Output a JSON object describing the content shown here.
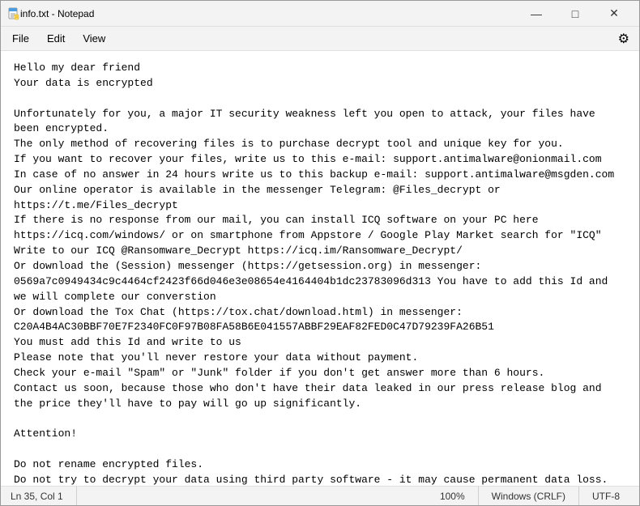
{
  "window": {
    "title": "info.txt - Notepad"
  },
  "menu": {
    "file_label": "File",
    "edit_label": "Edit",
    "view_label": "View"
  },
  "content": {
    "text": "Hello my dear friend\nYour data is encrypted\n\nUnfortunately for you, a major IT security weakness left you open to attack, your files have\nbeen encrypted.\nThe only method of recovering files is to purchase decrypt tool and unique key for you.\nIf you want to recover your files, write us to this e-mail: support.antimalware@onionmail.com\nIn case of no answer in 24 hours write us to this backup e-mail: support.antimalware@msgden.com\nOur online operator is available in the messenger Telegram: @Files_decrypt or\nhttps://t.me/Files_decrypt\nIf there is no response from our mail, you can install ICQ software on your PC here\nhttps://icq.com/windows/ or on smartphone from Appstore / Google Play Market search for \"ICQ\"\nWrite to our ICQ @Ransomware_Decrypt https://icq.im/Ransomware_Decrypt/\nOr download the (Session) messenger (https://getsession.org) in messenger:\n0569a7c0949434c9c4464cf2423f66d046e3e08654e4164404b1dc23783096d313 You have to add this Id and\nwe will complete our converstion\nOr download the Tox Chat (https://tox.chat/download.html) in messenger:\nC20A4B4AC30BBF70E7F2340FC0F97B08FA58B6E041557ABBF29EAF82FED0C47D79239FA26B51\nYou must add this Id and write to us\nPlease note that you'll never restore your data without payment.\nCheck your e-mail \"Spam\" or \"Junk\" folder if you don't get answer more than 6 hours.\nContact us soon, because those who don't have their data leaked in our press release blog and\nthe price they'll have to pay will go up significantly.\n\nAttention!\n\nDo not rename encrypted files.\nDo not try to decrypt your data using third party software - it may cause permanent data loss.\nWe are always ready to cooperate and find the best way to solve your problem.\nThe faster you write - the more favorable conditions will be for you."
  },
  "status_bar": {
    "position": "Ln 35, Col 1",
    "zoom": "100%",
    "line_ending": "Windows (CRLF)",
    "encoding": "UTF-8"
  },
  "icons": {
    "minimize": "—",
    "maximize": "□",
    "close": "✕",
    "settings": "⚙"
  }
}
